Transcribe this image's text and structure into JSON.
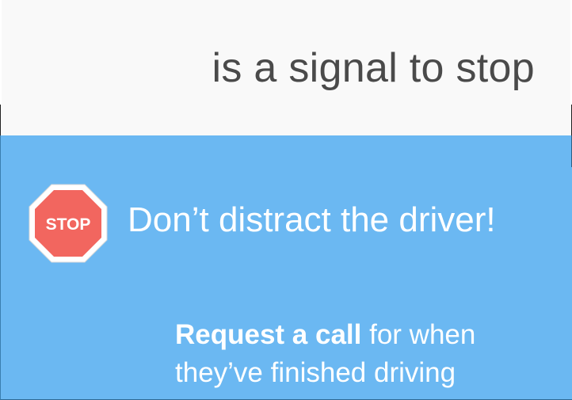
{
  "header": {
    "text": "is a signal to stop"
  },
  "stop_sign": {
    "label": "STOP",
    "fill_color": "#f2665f",
    "border_color": "#ffffff"
  },
  "main": {
    "message": "Don’t distract the driver!"
  },
  "request": {
    "bold_text": "Request a call",
    "rest_line1": " for when",
    "line2": "they’ve finished driving"
  },
  "colors": {
    "top_background": "#f9f9f9",
    "blue_background": "#6bb8f2",
    "header_text": "#4a4a4a",
    "white_text": "#ffffff"
  }
}
